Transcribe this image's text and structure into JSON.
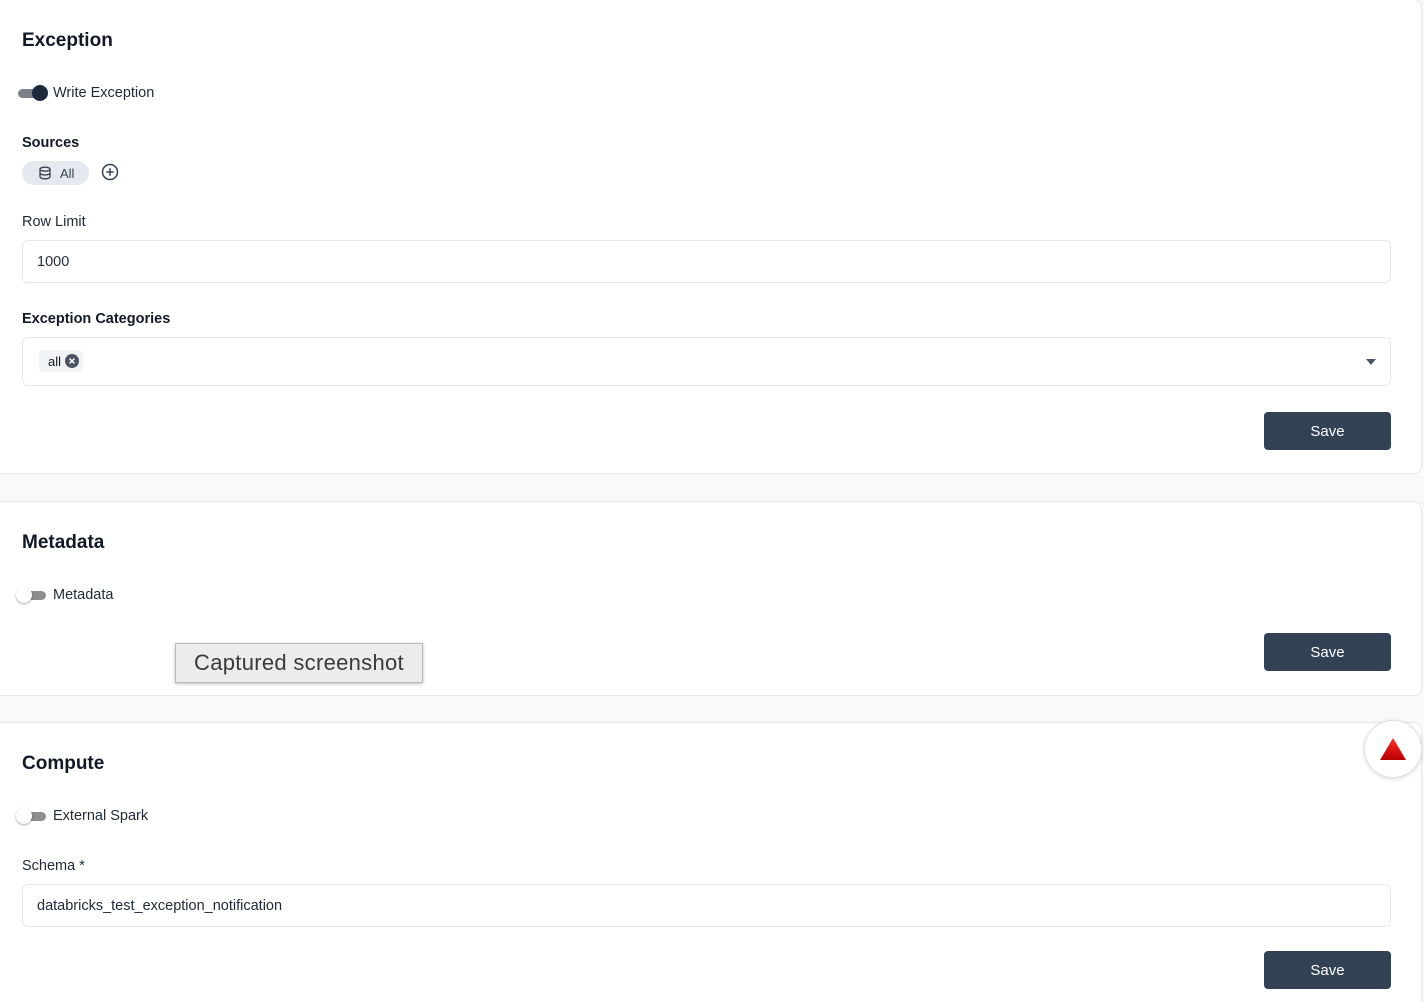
{
  "exception": {
    "title": "Exception",
    "toggle_label": "Write Exception",
    "toggle_on": true,
    "sources_label": "Sources",
    "sources_chip": "All",
    "row_limit_label": "Row Limit",
    "row_limit_value": "1000",
    "categories_label": "Exception Categories",
    "categories_selected": [
      "all"
    ],
    "save_label": "Save"
  },
  "metadata": {
    "title": "Metadata",
    "toggle_label": "Metadata",
    "toggle_on": false,
    "save_label": "Save"
  },
  "compute": {
    "title": "Compute",
    "toggle_label": "External Spark",
    "toggle_on": false,
    "schema_label": "Schema *",
    "schema_value": "databricks_test_exception_notification",
    "save_label": "Save"
  },
  "overlay": {
    "tooltip_text": "Captured screenshot"
  },
  "icons": {
    "sources_chip": "database-icon",
    "add": "plus-circle-icon",
    "remove_tag": "close-circle-icon",
    "dropdown": "caret-down-icon",
    "fab": "warning-triangle-icon"
  },
  "colors": {
    "primary_button": "#334155",
    "toggle_on_knob": "#1e293b",
    "fab_icon": "#d00000"
  }
}
